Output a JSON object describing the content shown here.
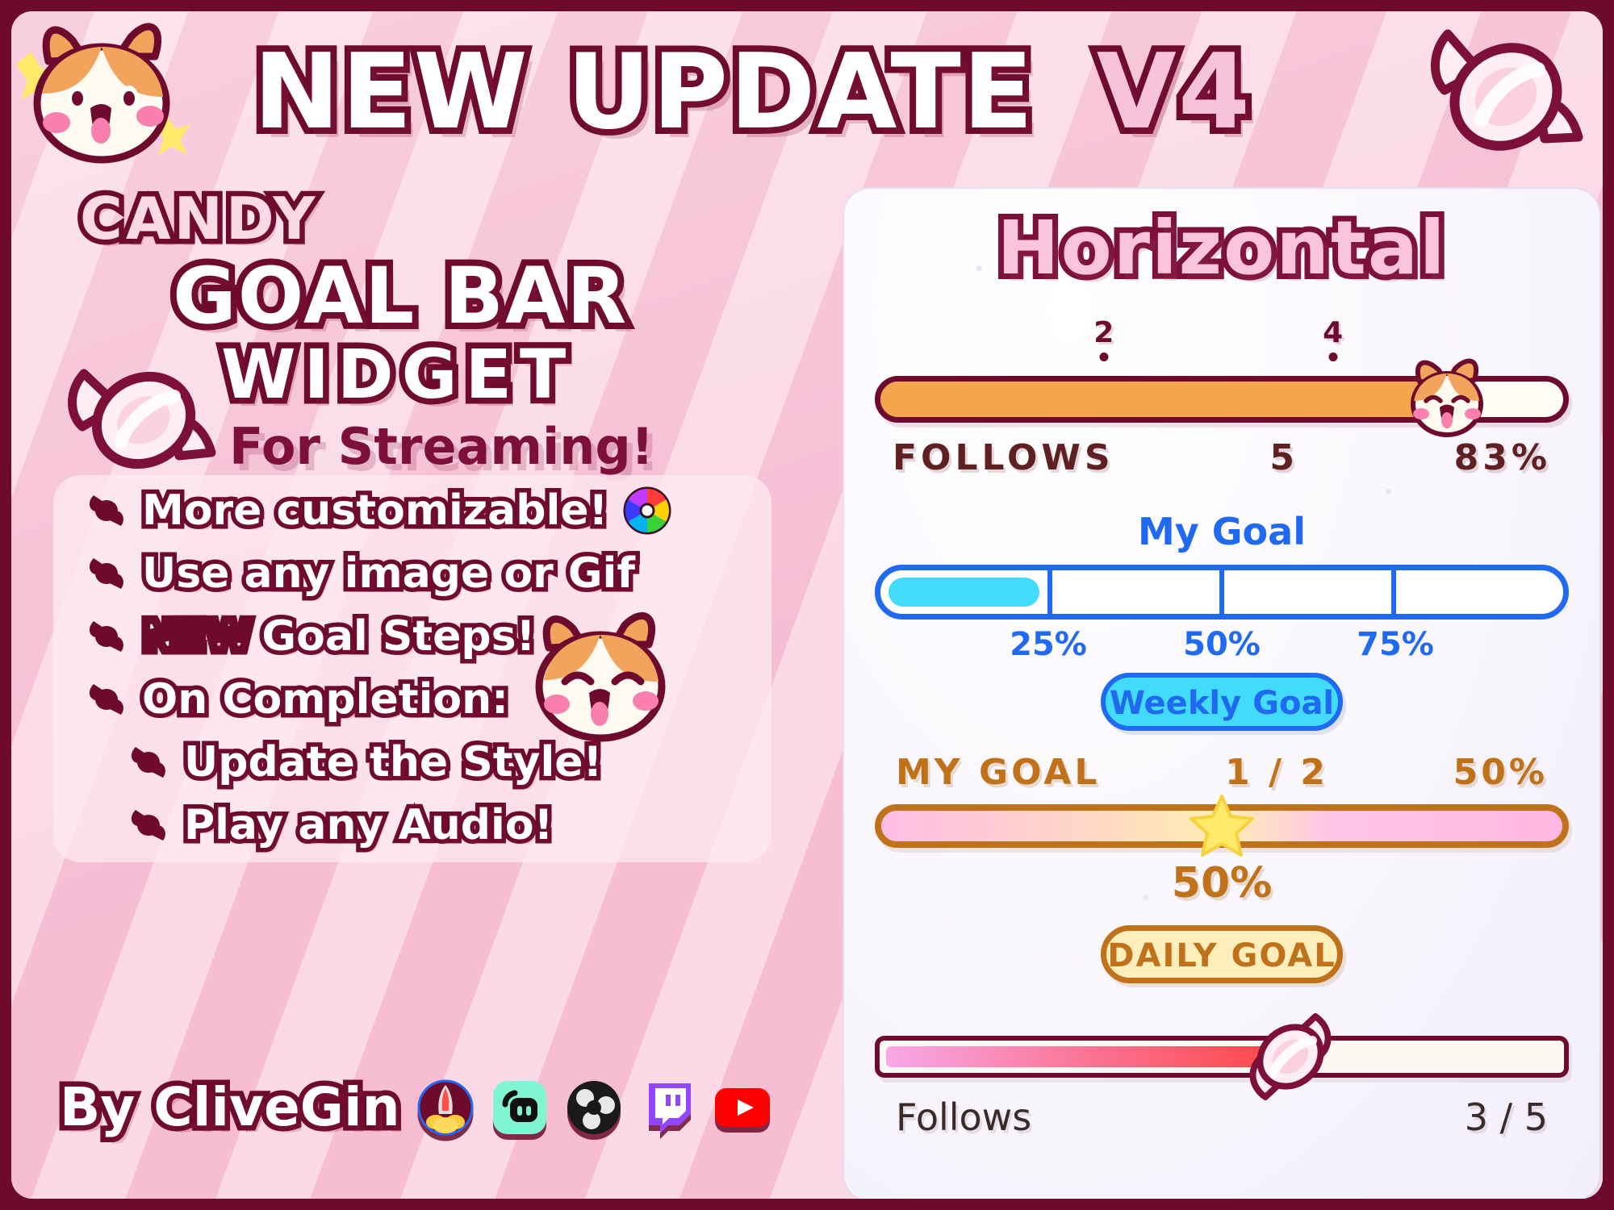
{
  "header": {
    "title_part1": "NEW UPDATE",
    "title_part2": "V4",
    "cat_icon": "cat-face-icon",
    "candy_icon": "candy-wrapped-icon"
  },
  "left": {
    "candy_word": "CANDY",
    "goalbar_word": "GOAL BAR",
    "widget_word": "WIDGET",
    "streaming_word": "For Streaming!",
    "features": [
      {
        "text": "More customizable!",
        "bullet": "candy-bullet-icon",
        "trailing_icon": "color-wheel-icon"
      },
      {
        "text": "Use any image or Gif",
        "bullet": "candy-bullet-icon"
      },
      {
        "prefix": "NEW",
        "text": " Goal Steps!",
        "bullet": "candy-bullet-icon",
        "highlight": true
      },
      {
        "text": "On Completion:",
        "bullet": "candy-bullet-icon"
      },
      {
        "text": "Update the Style!",
        "bullet": "candy-bullet-icon",
        "indent": true
      },
      {
        "text": "Play any Audio!",
        "bullet": "candy-bullet-icon",
        "indent": true
      }
    ],
    "byline": "By CliveGin",
    "platform_icons": [
      "streamelements-rocket-icon",
      "streamlabs-icon",
      "obs-studio-icon",
      "twitch-icon",
      "youtube-icon"
    ],
    "cat_icon_2": "cat-face-winking-icon",
    "candy_icon_2": "candy-wrapped-icon"
  },
  "panel": {
    "title": "Horizontal",
    "bars": [
      {
        "id": "follows-orange-bar",
        "step_labels": [
          "2",
          "4"
        ],
        "step_positions_pct": [
          33,
          66
        ],
        "fill_pct": 83,
        "thumb": "cat-face-thumb-icon",
        "label_left": "FOLLOWS",
        "label_center": "5",
        "label_right": "83%",
        "fill_color": "#f7a44f",
        "border_color": "#6d0a2e"
      },
      {
        "id": "my-goal-blue-bar",
        "title": "My Goal",
        "segments": 4,
        "fill_pct": 25,
        "segment_labels": [
          "25%",
          "50%",
          "75%"
        ],
        "segment_label_positions_pct": [
          25,
          50,
          75
        ],
        "button_label": "Weekly Goal",
        "fill_color": "#43dbfb",
        "border_color": "#1f6af0"
      },
      {
        "id": "daily-goal-star-bar",
        "label_left": "MY GOAL",
        "label_center": "1 / 2",
        "label_right": "50%",
        "fill_pct": 50,
        "thumb": "star-thumb-icon",
        "percent_label": "50%",
        "button_label": "DAILY GOAL",
        "border_color": "#c0721b"
      },
      {
        "id": "follows-candy-bar",
        "fill_pct": 60,
        "thumb": "candy-thumb-icon",
        "label_left": "Follows",
        "label_right": "3 / 5",
        "border_color": "#6d0a2e"
      }
    ]
  },
  "colors": {
    "frame": "#6d0a2e",
    "bg_light": "#fbd9e6",
    "bg_dark": "#f6bdd3",
    "accent_orange": "#f7a44f",
    "accent_blue": "#1f6af0",
    "accent_cyan": "#43dbfb",
    "accent_brown": "#c0721b",
    "accent_red": "#ff4444"
  }
}
